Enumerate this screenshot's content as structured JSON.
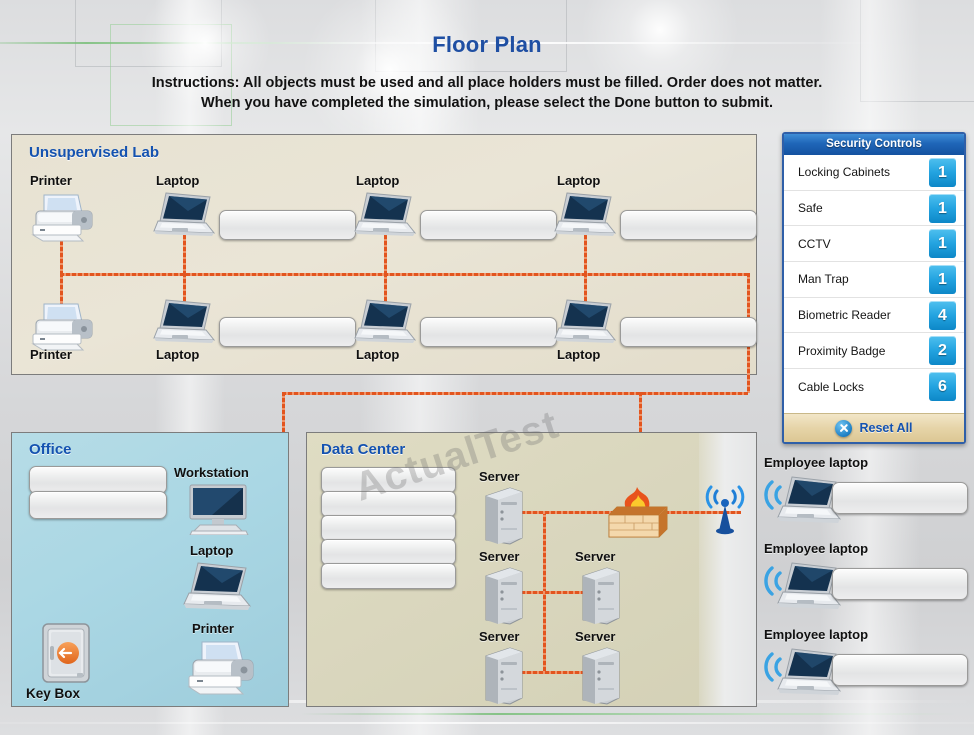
{
  "header": {
    "title": "Floor Plan",
    "instructions_line1": "Instructions: All objects must be used and all place holders must be filled. Order does not matter.",
    "instructions_line2": "When you have completed the simulation, please select the Done button to submit."
  },
  "watermark": "ActualTest",
  "zones": {
    "lab": {
      "title": "Unsupervised Lab",
      "devices": [
        {
          "label": "Printer",
          "icon": "printer-icon"
        },
        {
          "label": "Laptop",
          "icon": "laptop-icon"
        },
        {
          "label": "Laptop",
          "icon": "laptop-icon"
        },
        {
          "label": "Laptop",
          "icon": "laptop-icon"
        },
        {
          "label": "Printer",
          "icon": "printer-icon"
        },
        {
          "label": "Laptop",
          "icon": "laptop-icon"
        },
        {
          "label": "Laptop",
          "icon": "laptop-icon"
        },
        {
          "label": "Laptop",
          "icon": "laptop-icon"
        }
      ],
      "slot_count": 6
    },
    "office": {
      "title": "Office",
      "devices": [
        {
          "label": "Workstation",
          "icon": "workstation-icon"
        },
        {
          "label": "Laptop",
          "icon": "laptop-icon"
        },
        {
          "label": "Printer",
          "icon": "printer-icon"
        },
        {
          "label": "Key Box",
          "icon": "safe-icon"
        }
      ],
      "slot_count": 2
    },
    "data_center": {
      "title": "Data Center",
      "devices": [
        {
          "label": "Server",
          "icon": "server-icon"
        },
        {
          "label": "Server",
          "icon": "server-icon"
        },
        {
          "label": "Server",
          "icon": "server-icon"
        },
        {
          "label": "Server",
          "icon": "server-icon"
        },
        {
          "label": "Server",
          "icon": "server-icon"
        }
      ],
      "firewall_icon": "firewall-icon",
      "access_point_icon": "wireless-access-point-icon",
      "slot_count": 5
    }
  },
  "security_controls": {
    "panel_title": "Security Controls",
    "items": [
      {
        "name": "Locking Cabinets",
        "count": "1"
      },
      {
        "name": "Safe",
        "count": "1"
      },
      {
        "name": "CCTV",
        "count": "1"
      },
      {
        "name": "Man Trap",
        "count": "1"
      },
      {
        "name": "Biometric Reader",
        "count": "4"
      },
      {
        "name": "Proximity Badge",
        "count": "2"
      },
      {
        "name": "Cable Locks",
        "count": "6"
      }
    ],
    "reset_label": "Reset  All",
    "reset_icon": "close-circle-icon"
  },
  "employee_laptops": [
    {
      "label": "Employee laptop",
      "icon": "wireless-laptop-icon"
    },
    {
      "label": "Employee laptop",
      "icon": "wireless-laptop-icon"
    },
    {
      "label": "Employee laptop",
      "icon": "wireless-laptop-icon"
    }
  ],
  "colors": {
    "title_blue": "#1f4fa3",
    "zone_title_blue": "#1452b0",
    "wire_orange": "#e2551f",
    "badge_blue": "#23a3e0",
    "panel_border": "#2f5fa8",
    "lab_bg": "#e7e2d2",
    "office_bg": "#aad7e4",
    "data_center_bg": "#d9d6bd"
  }
}
